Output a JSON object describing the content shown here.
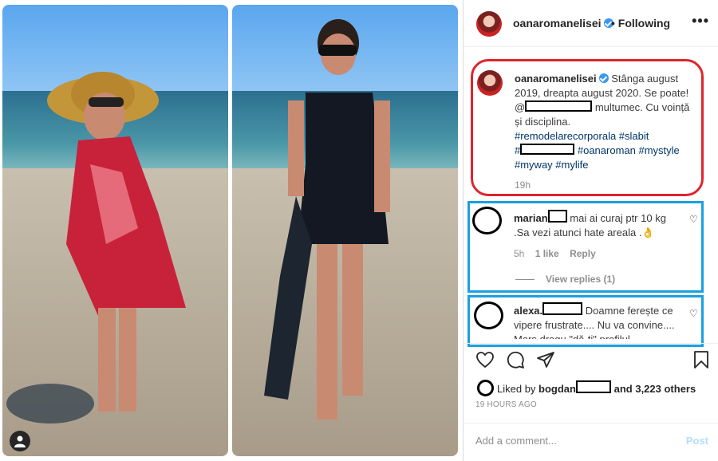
{
  "post": {
    "username": "oanaromanelisei",
    "follow_status": "• Following",
    "more": "•••",
    "caption": {
      "part1": "Stânga august 2019, dreapta august 2020. Se poate!",
      "mention_prefix": "@",
      "part2": "multumec. Cu voință și disciplina.",
      "tags_line1": "#remodelarecorporala #slabit",
      "hash_prefix": "#",
      "tags_line2": "#oanaroman #mystyle",
      "tags_line3": "#myway #mylife",
      "time": "19h"
    },
    "comments": [
      {
        "user": "marian",
        "text": "mai ai curaj ptr 10 kg .Sa vezi atunci hate areala .👌",
        "time": "5h",
        "likes": "1 like",
        "reply": "Reply",
        "view_replies": "View replies (1)"
      },
      {
        "user": "alexa.",
        "text": "Doamne ferește ce vipere frustrate.... Nu va convine.... Mars dragu \"dă-ți\" profilul"
      }
    ],
    "likes": {
      "prefix": "Liked by",
      "user": "bogdan",
      "suffix": "and 3,223 others"
    },
    "date": "19 HOURS AGO",
    "add_comment_placeholder": "Add a comment...",
    "post_button": "Post"
  },
  "icons": [
    "heart-icon",
    "comment-icon",
    "share-icon",
    "bookmark-icon",
    "user-icon",
    "more-icon",
    "verified-icon"
  ],
  "colors": {
    "annotation_red": "#e0242c",
    "annotation_blue": "#1aa0e0",
    "verified": "#3897f0",
    "hashtag": "#003569"
  }
}
